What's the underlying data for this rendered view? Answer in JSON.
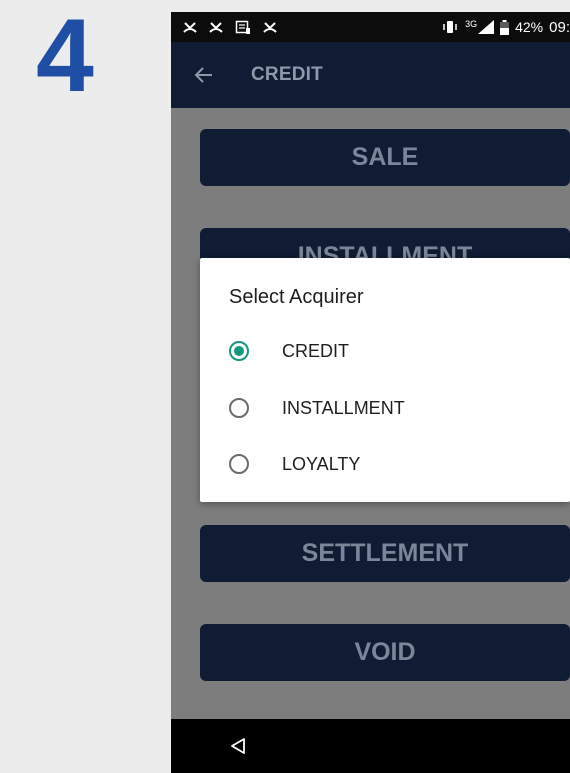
{
  "step": {
    "number": "4"
  },
  "status_bar": {
    "left_icons": [
      "missed-call-icon",
      "missed-call-icon",
      "message-icon",
      "missed-call-icon"
    ],
    "right_icons": [
      "vibrate-icon",
      "signal-icon",
      "battery-icon"
    ],
    "network": "3G",
    "battery_percent": "42%",
    "time": "09:"
  },
  "app_bar": {
    "back_icon": "arrow-left-icon",
    "title": "CREDIT"
  },
  "menu": {
    "sale": "SALE",
    "installment": "INSTALLMENT",
    "settlement": "SETTLEMENT",
    "void": "VOID"
  },
  "dialog": {
    "title": "Select Acquirer",
    "options": [
      {
        "label": "CREDIT",
        "selected": true
      },
      {
        "label": "INSTALLMENT",
        "selected": false
      },
      {
        "label": "LOYALTY",
        "selected": false
      }
    ]
  },
  "nav_bar": {
    "back_icon": "triangle-back-icon"
  },
  "colors": {
    "step_number": "#1f4fa5",
    "app_bar": "#0f1c33",
    "button": "#0f1c33",
    "accent_radio": "#13987f",
    "scrim_background": "#7d7d7d"
  }
}
